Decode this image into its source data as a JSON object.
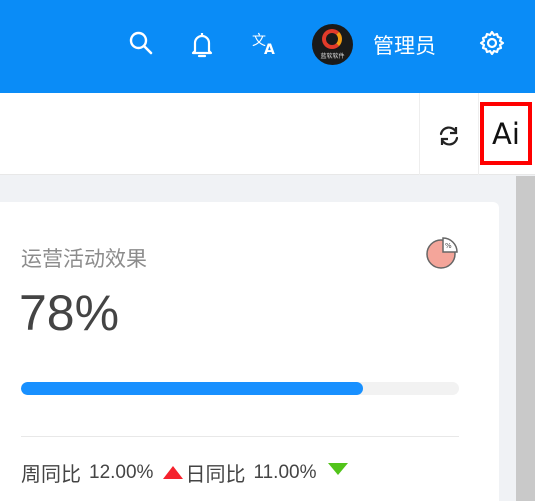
{
  "header": {
    "icons": [
      "search-icon",
      "bell-icon",
      "translate-icon",
      "gear-icon"
    ],
    "avatar_caption": "蓝软软件",
    "user_name": "管理员",
    "bg_color": "#0a8cf7"
  },
  "toolbar": {
    "refresh_icon": "refresh-icon",
    "ai_label": "Ai",
    "highlight_color": "#ff0000"
  },
  "card": {
    "title": "运营活动效果",
    "icon": "pie-chart-icon",
    "value": "78%",
    "progress": 0.78,
    "progress_color": "#1890ff",
    "week_label": "周同比",
    "week_value": "12.00%",
    "week_trend": "up",
    "day_label": "日同比",
    "day_value": "11.00%",
    "day_trend": "down",
    "up_color": "#f5222d",
    "down_color": "#52c41a"
  }
}
